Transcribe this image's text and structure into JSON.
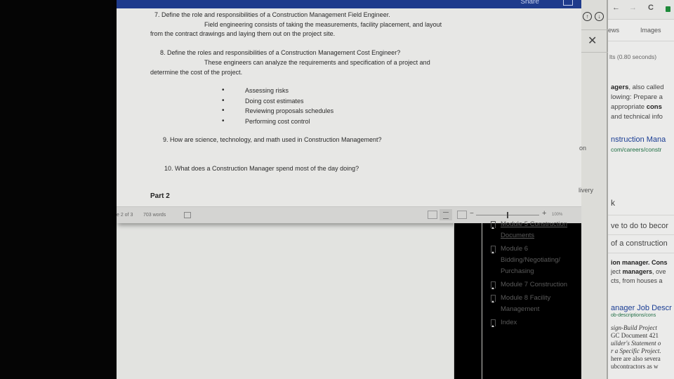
{
  "word": {
    "titlebar": {
      "share_label": "Share"
    },
    "document": {
      "q7": {
        "question": "7.   Define the role and responsibilities of a Construction Management Field Engineer.",
        "answer_line1": "Field engineering consists of taking the measurements, facility placement, and layout",
        "answer_line2": "from the contract drawings and laying them out on the project site."
      },
      "q8": {
        "question": "8.   Define the roles and responsibilities of a Construction Management Cost Engineer?",
        "answer_line1": "These engineers can analyze the requirements and specification of a project and",
        "answer_line2": "determine the cost of the project.",
        "bullets": [
          "Assessing risks",
          "Doing cost estimates",
          "Reviewing proposals schedules",
          "Performing cost control"
        ]
      },
      "q9": {
        "question": "9.   How are science, technology, and math used in Construction Management?"
      },
      "q10": {
        "question": "10.  What does a Construction Manager spend most of the day doing?"
      },
      "part_heading": "Part 2"
    },
    "statusbar": {
      "page_info": "e 2 of 3",
      "word_count": "703 words",
      "zoom_level": "100%",
      "zoom_percent": 100,
      "zoom_minus": "−",
      "zoom_plus": "+"
    }
  },
  "side_panel": {
    "up_icon": "↑",
    "down_icon": "↓",
    "close_icon": "✕"
  },
  "peek": {
    "on": "on",
    "livery": "livery"
  },
  "bookmarks": [
    {
      "label_lines": [
        "Module 5 Construction",
        "Documents"
      ],
      "current": true
    },
    {
      "label_lines": [
        "Module 6",
        "Bidding/Negotiating/",
        "Purchasing"
      ],
      "current": false
    },
    {
      "label_lines": [
        "Module 7 Construction"
      ],
      "current": false
    },
    {
      "label_lines": [
        "Module 8 Facility",
        "Management"
      ],
      "current": false
    },
    {
      "label_lines": [
        "Index"
      ],
      "current": false
    }
  ],
  "browser": {
    "back": "←",
    "forward": "→",
    "reload": "C",
    "tabs": {
      "news": "ews",
      "images": "Images"
    },
    "result_stats": "lts (0.80 seconds)",
    "snippet1": {
      "line1_bold": "agers",
      "line1_rest": ", also called",
      "line2": "lowing: Prepare a",
      "line3_pre": " appropriate ",
      "line3_bold": "cons",
      "line4": "and technical info"
    },
    "result1": {
      "title": "nstruction Mana",
      "url": "com/careers/constr"
    },
    "related_k": "k",
    "related1": "ve to do to becor",
    "related2": "of a construction",
    "snippet2": {
      "line1_bold": "ion manager",
      "line1_rest": ". Cons",
      "line2_pre": "ject ",
      "line2_bold": "managers",
      "line2_rest": ", ove",
      "line3": "cts, from houses a"
    },
    "result2": {
      "title": "anager Job Descr",
      "url": "ob-descriptions/cons"
    },
    "book_excerpt": [
      "sign-Build Project",
      "GC Document 421",
      "uilder's Statement o",
      "r a Specific Project.",
      "here are also severa",
      "ubcontractors as w"
    ]
  }
}
